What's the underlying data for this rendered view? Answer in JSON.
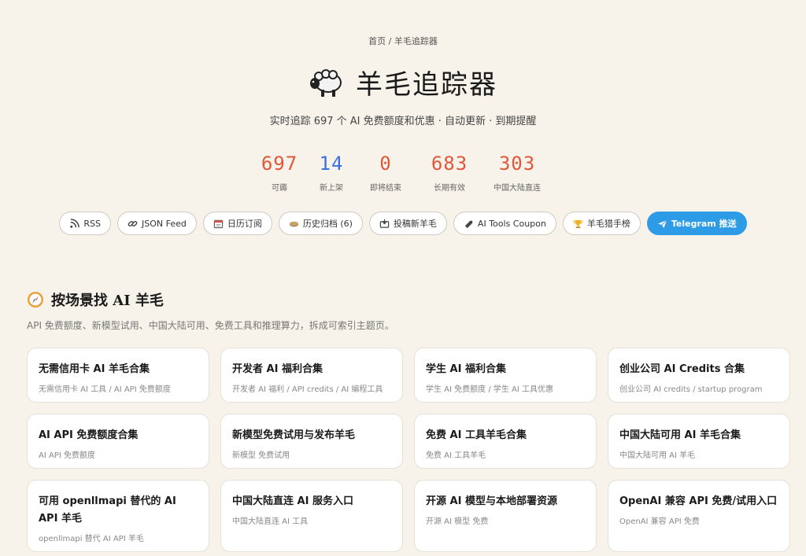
{
  "breadcrumb": {
    "home": "首页",
    "sep": "/",
    "current": "羊毛追踪器"
  },
  "header": {
    "title": "羊毛追踪器",
    "subtitle": "实时追踪 697 个 AI 免费额度和优惠 · 自动更新 · 到期提醒"
  },
  "stats": [
    {
      "value": "697",
      "label": "可薅",
      "color": "#e0573a"
    },
    {
      "value": "14",
      "label": "新上架",
      "color": "#3a6fe0"
    },
    {
      "value": "0",
      "label": "即将结束",
      "color": "#e0573a"
    },
    {
      "value": "683",
      "label": "长期有效",
      "color": "#e0573a"
    },
    {
      "value": "303",
      "label": "中国大陆直连",
      "color": "#e0573a"
    }
  ],
  "toolbar": [
    {
      "icon": "rss-icon",
      "label": "RSS"
    },
    {
      "icon": "link-icon",
      "label": "JSON Feed"
    },
    {
      "icon": "calendar-icon",
      "label": "日历订阅"
    },
    {
      "icon": "archive-icon",
      "label": "历史归档 (6)"
    },
    {
      "icon": "inbox-icon",
      "label": "投稿新羊毛"
    },
    {
      "icon": "tag-icon",
      "label": "AI Tools Coupon"
    },
    {
      "icon": "trophy-icon",
      "label": "羊毛猎手榜"
    },
    {
      "icon": "send-icon",
      "label": "Telegram 推送"
    }
  ],
  "colors": {
    "accent": "#2d9be6",
    "background": "#f7f3ea"
  },
  "section": {
    "title": "按场景找 AI 羊毛",
    "description": "API 免费额度、新模型试用、中国大陆可用、免费工具和推理算力，拆成可索引主题页。"
  },
  "cards": [
    {
      "title": "无需信用卡 AI 羊毛合集",
      "tags": "无需信用卡 AI 工具 / AI API 免费额度"
    },
    {
      "title": "开发者 AI 福利合集",
      "tags": "开发者 AI 福利 / API credits / AI 编程工具"
    },
    {
      "title": "学生 AI 福利合集",
      "tags": "学生 AI 免费额度 / 学生 AI 工具优惠"
    },
    {
      "title": "创业公司 AI Credits 合集",
      "tags": "创业公司 AI credits / startup program"
    },
    {
      "title": "AI API 免费额度合集",
      "tags": "AI API 免费额度"
    },
    {
      "title": "新模型免费试用与发布羊毛",
      "tags": "新模型 免费试用"
    },
    {
      "title": "免费 AI 工具羊毛合集",
      "tags": "免费 AI 工具羊毛"
    },
    {
      "title": "中国大陆可用 AI 羊毛合集",
      "tags": "中国大陆可用 AI 羊毛"
    },
    {
      "title": "可用 openllmapi 替代的 AI API 羊毛",
      "tags": "openllmapi 替代 AI API 羊毛"
    },
    {
      "title": "中国大陆直连 AI 服务入口",
      "tags": "中国大陆直连 AI 工具"
    },
    {
      "title": "开源 AI 模型与本地部署资源",
      "tags": "开源 AI 模型 免费"
    },
    {
      "title": "OpenAI 兼容 API 免费/试用入口",
      "tags": "OpenAI 兼容 API 免费"
    }
  ]
}
